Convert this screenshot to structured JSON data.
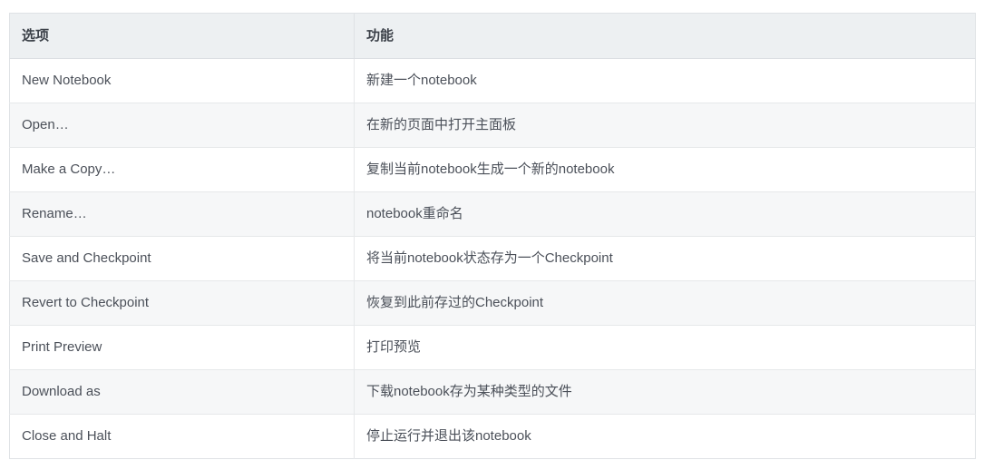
{
  "table": {
    "headers": [
      {
        "label": "选项"
      },
      {
        "label": "功能"
      }
    ],
    "rows": [
      {
        "option": "New Notebook",
        "function": "新建一个notebook"
      },
      {
        "option": "Open…",
        "function": "在新的页面中打开主面板"
      },
      {
        "option": "Make a Copy…",
        "function": "复制当前notebook生成一个新的notebook"
      },
      {
        "option": "Rename…",
        "function": "notebook重命名"
      },
      {
        "option": "Save and Checkpoint",
        "function": "将当前notebook状态存为一个Checkpoint"
      },
      {
        "option": "Revert to Checkpoint",
        "function": "恢复到此前存过的Checkpoint"
      },
      {
        "option": "Print Preview",
        "function": "打印预览"
      },
      {
        "option": "Download as",
        "function": "下载notebook存为某种类型的文件"
      },
      {
        "option": "Close and Halt",
        "function": "停止运行并退出该notebook"
      }
    ],
    "colors": {
      "header_background": "#edf0f2",
      "header_text": "#3c4149",
      "body_text": "#4b5059",
      "row_odd_background": "#ffffff",
      "row_even_background": "#f6f7f8",
      "border": "#dfe2e5",
      "page_background": "#ffffff"
    }
  }
}
